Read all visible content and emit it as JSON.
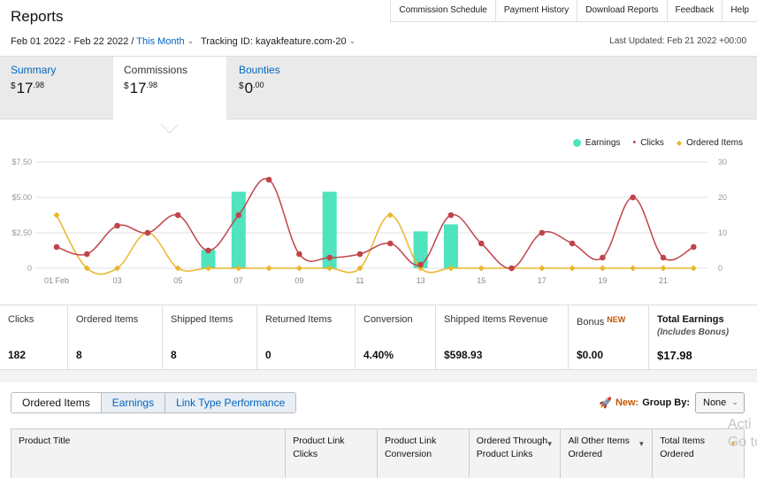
{
  "header": {
    "title": "Reports",
    "nav": [
      "Commission Schedule",
      "Payment History",
      "Download Reports",
      "Feedback",
      "Help"
    ],
    "date_range": "Feb 01 2022 - Feb 22 2022 /",
    "range_preset": "This Month",
    "tracking_label": "Tracking ID:",
    "tracking_id": "kayakfeature.com-20",
    "last_updated": "Last Updated: Feb 21 2022 +00:00"
  },
  "summary_tabs": [
    {
      "label": "Summary",
      "currency": "$",
      "whole": "17",
      "cents": ".98"
    },
    {
      "label": "Commissions",
      "currency": "$",
      "whole": "17",
      "cents": ".98"
    },
    {
      "label": "Bounties",
      "currency": "$",
      "whole": "0",
      "cents": ".00"
    }
  ],
  "legend": {
    "earnings": "Earnings",
    "clicks": "Clicks",
    "ordered": "Ordered Items"
  },
  "colors": {
    "earnings": "#4fe3be",
    "clicks": "#c0444a",
    "ordered": "#e8b72c",
    "link": "#0066c0",
    "accent": "#c45500"
  },
  "chart_data": {
    "type": "line",
    "x": [
      "01 Feb",
      "02",
      "03",
      "04",
      "05",
      "06",
      "07",
      "08",
      "09",
      "10",
      "11",
      "12",
      "13",
      "14",
      "15",
      "16",
      "17",
      "18",
      "19",
      "20",
      "21",
      "22"
    ],
    "x_tick_labels": [
      "01 Feb",
      "03",
      "05",
      "07",
      "09",
      "11",
      "13",
      "15",
      "17",
      "19",
      "21"
    ],
    "left_axis": {
      "ticks": [
        "0",
        "$2.50",
        "$5.00",
        "$7.50"
      ],
      "ylim": [
        0,
        7.5
      ]
    },
    "right_axis": {
      "ticks": [
        "0",
        "10",
        "20",
        "30"
      ],
      "ylim": [
        0,
        30
      ]
    },
    "series": [
      {
        "name": "Earnings",
        "type": "bar",
        "axis": "left",
        "values": [
          0,
          0,
          0,
          0,
          0,
          1.3,
          5.4,
          0,
          0,
          5.4,
          0,
          0,
          2.6,
          3.1,
          0,
          0,
          0,
          0,
          0,
          0,
          0,
          0
        ]
      },
      {
        "name": "Clicks",
        "type": "line",
        "axis": "right",
        "values": [
          6,
          4,
          12,
          10,
          15,
          5,
          15,
          25,
          4,
          3,
          4,
          7,
          1,
          15,
          7,
          0,
          10,
          7,
          3,
          20,
          3,
          6
        ]
      },
      {
        "name": "Ordered Items",
        "type": "line",
        "axis": "right",
        "values": [
          15,
          0,
          0,
          10,
          0,
          0,
          0,
          0,
          0,
          0,
          0,
          15,
          0,
          0,
          0,
          0,
          0,
          0,
          0,
          0,
          0,
          0
        ]
      }
    ]
  },
  "metrics": [
    {
      "label": "Clicks",
      "value": "182"
    },
    {
      "label": "Ordered Items",
      "value": "8"
    },
    {
      "label": "Shipped Items",
      "value": "8"
    },
    {
      "label": "Returned Items",
      "value": "0"
    },
    {
      "label": "Conversion",
      "value": "4.40%"
    },
    {
      "label": "Shipped Items Revenue",
      "value": "$598.93"
    },
    {
      "label": "Bonus",
      "new": "NEW",
      "value": "$0.00"
    },
    {
      "label": "Total Earnings",
      "sub": "(Includes Bonus)",
      "value": "$17.98"
    }
  ],
  "bottom_tabs": [
    "Ordered Items",
    "Earnings",
    "Link Type Performance"
  ],
  "group_by": {
    "new": "New:",
    "label": "Group By:",
    "value": "None"
  },
  "table_headers": [
    "Product Title",
    "Product Link Clicks",
    "Product Link Conversion",
    "Ordered Through Product Links",
    "All Other Items Ordered",
    "Total Items Ordered"
  ],
  "watermark": "Acti\nGo to"
}
